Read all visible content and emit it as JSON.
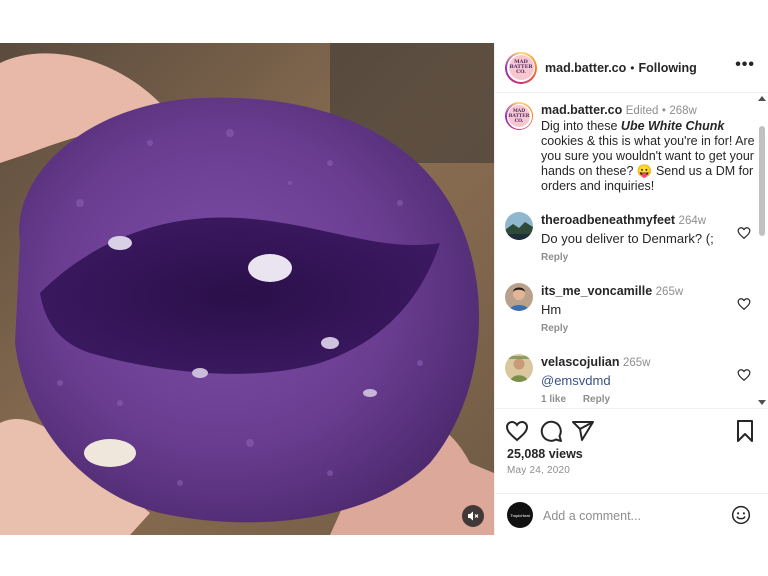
{
  "post": {
    "author": "mad.batter.co",
    "avatar_text": "MAD BATTER CO.",
    "separator": "•",
    "follow_status": "Following",
    "more_label": "•••"
  },
  "caption": {
    "author": "mad.batter.co",
    "edited": "Edited",
    "dot": "•",
    "time": "268w",
    "text_before": "Dig into these ",
    "highlight": "Ube White Chunk",
    "text_after": " cookies & this is what you're in for! Are you sure you wouldn't want to get your hands on these? 😛 Send us a DM for orders and inquiries!"
  },
  "comments": [
    {
      "user": "theroadbeneathmyfeet",
      "time": "264w",
      "text": "Do you deliver to Denmark? (;",
      "likes": "",
      "reply": "Reply",
      "avatar": "landscape"
    },
    {
      "user": "its_me_voncamille",
      "time": "265w",
      "text": "Hm",
      "likes": "",
      "reply": "Reply",
      "avatar": "person"
    },
    {
      "user": "velascojulian",
      "time": "265w",
      "text": "@emsvdmd",
      "likes": "1 like",
      "reply": "Reply",
      "avatar": "person2"
    }
  ],
  "stats": {
    "views": "25,088 views",
    "date": "May 24, 2020"
  },
  "composer": {
    "placeholder": "Add a comment...",
    "avatar_text": "TropicHeat"
  },
  "icons": [
    "heart-icon",
    "comment-icon",
    "share-icon",
    "bookmark-icon",
    "speaker-muted-icon",
    "emoji-icon",
    "more-icon"
  ],
  "colors": {
    "cookie_purple": "#6a3d91",
    "link_blue": "#385185",
    "muted_text": "#8e8e8e",
    "border": "#efefef"
  }
}
